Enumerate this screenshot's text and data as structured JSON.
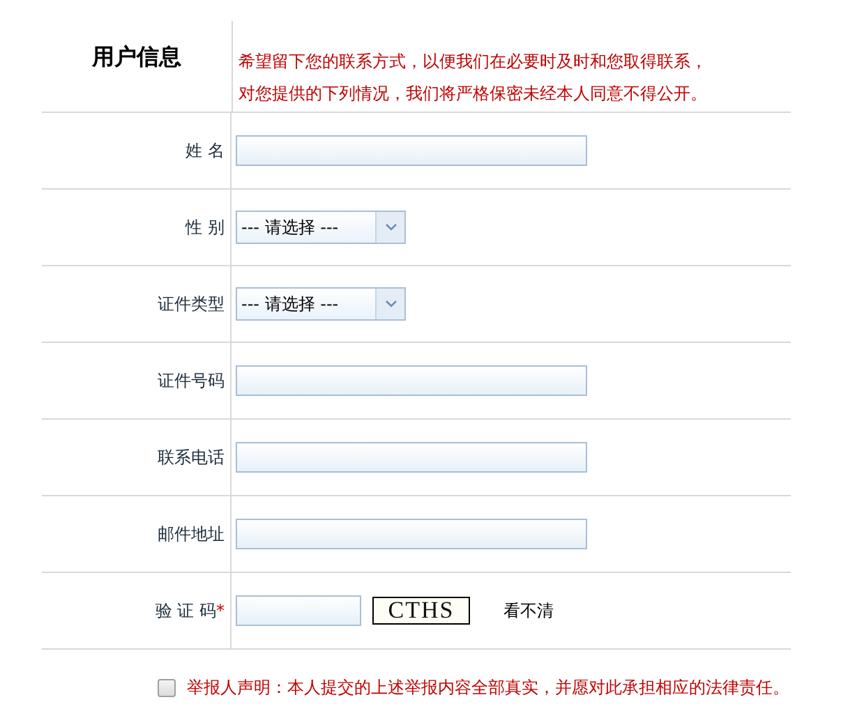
{
  "header": {
    "title": "用户信息",
    "notice_lines": [
      "希望留下您的联系方式，以便我们在必要时及时和您取得联系，",
      "对您提供的下列情况，我们将严格保密未经本人同意不得公开。"
    ]
  },
  "fields": [
    {
      "label": "姓 名",
      "kind": "text"
    },
    {
      "label": "性 别",
      "kind": "select",
      "value": "--- 请选择 ---"
    },
    {
      "label": "证件类型",
      "kind": "select",
      "value": "--- 请选择 ---"
    },
    {
      "label": "证件号码",
      "kind": "text"
    },
    {
      "label": "联系电话",
      "kind": "text"
    },
    {
      "label": "邮件地址",
      "kind": "text"
    },
    {
      "label": "验 证 码",
      "kind": "captcha",
      "required_mark": "*",
      "captcha_text": "CTHS",
      "refresh_link": "看不清"
    }
  ],
  "declaration": {
    "checked": false,
    "text": "举报人声明：本人提交的上述举报内容全部真实，并愿对此承担相应的法律责任。"
  }
}
